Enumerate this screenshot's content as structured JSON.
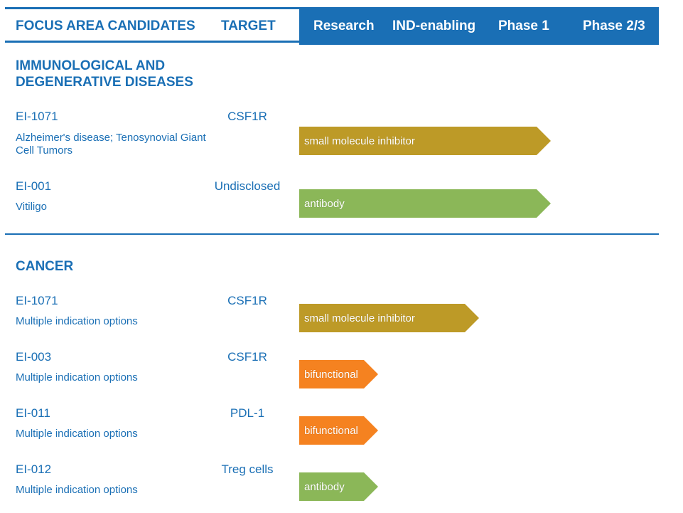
{
  "header": {
    "col_candidates": "FOCUS AREA CANDIDATES",
    "col_target": "TARGET",
    "col_research": "Research",
    "col_ind": "IND-enabling",
    "col_phase1": "Phase 1",
    "col_phase23": "Phase 2/3"
  },
  "colors": {
    "brand_blue": "#1a6fb5",
    "small_molecule": "#bd9a27",
    "antibody": "#8bb758",
    "bifunctional": "#f58220"
  },
  "sections": [
    {
      "title_line1": "IMMUNOLOGICAL AND",
      "title_line2": "DEGENERATIVE DISEASES",
      "candidates": [
        {
          "id": "EI-1071",
          "indication": "Alzheimer's disease; Tenosynovial Giant Cell Tumors",
          "target": "CSF1R",
          "modality": "small molecule inhibitor",
          "stage": "Phase 1"
        },
        {
          "id": "EI-001",
          "indication": "Vitiligo",
          "target": "Undisclosed",
          "modality": "antibody",
          "stage": "Phase 1"
        }
      ]
    },
    {
      "title_line1": "CANCER",
      "candidates": [
        {
          "id": "EI-1071",
          "indication": "Multiple indication options",
          "target": "CSF1R",
          "modality": "small molecule inhibitor",
          "stage": "IND-enabling"
        },
        {
          "id": "EI-003",
          "indication": "Multiple indication options",
          "target": "CSF1R",
          "modality": "bifunctional",
          "stage": "Research"
        },
        {
          "id": "EI-011",
          "indication": "Multiple indication options",
          "target": "PDL-1",
          "modality": "bifunctional",
          "stage": "Research"
        },
        {
          "id": "EI-012",
          "indication": "Multiple indication options",
          "target": "Treg cells",
          "modality": "antibody",
          "stage": "Research"
        }
      ]
    }
  ]
}
